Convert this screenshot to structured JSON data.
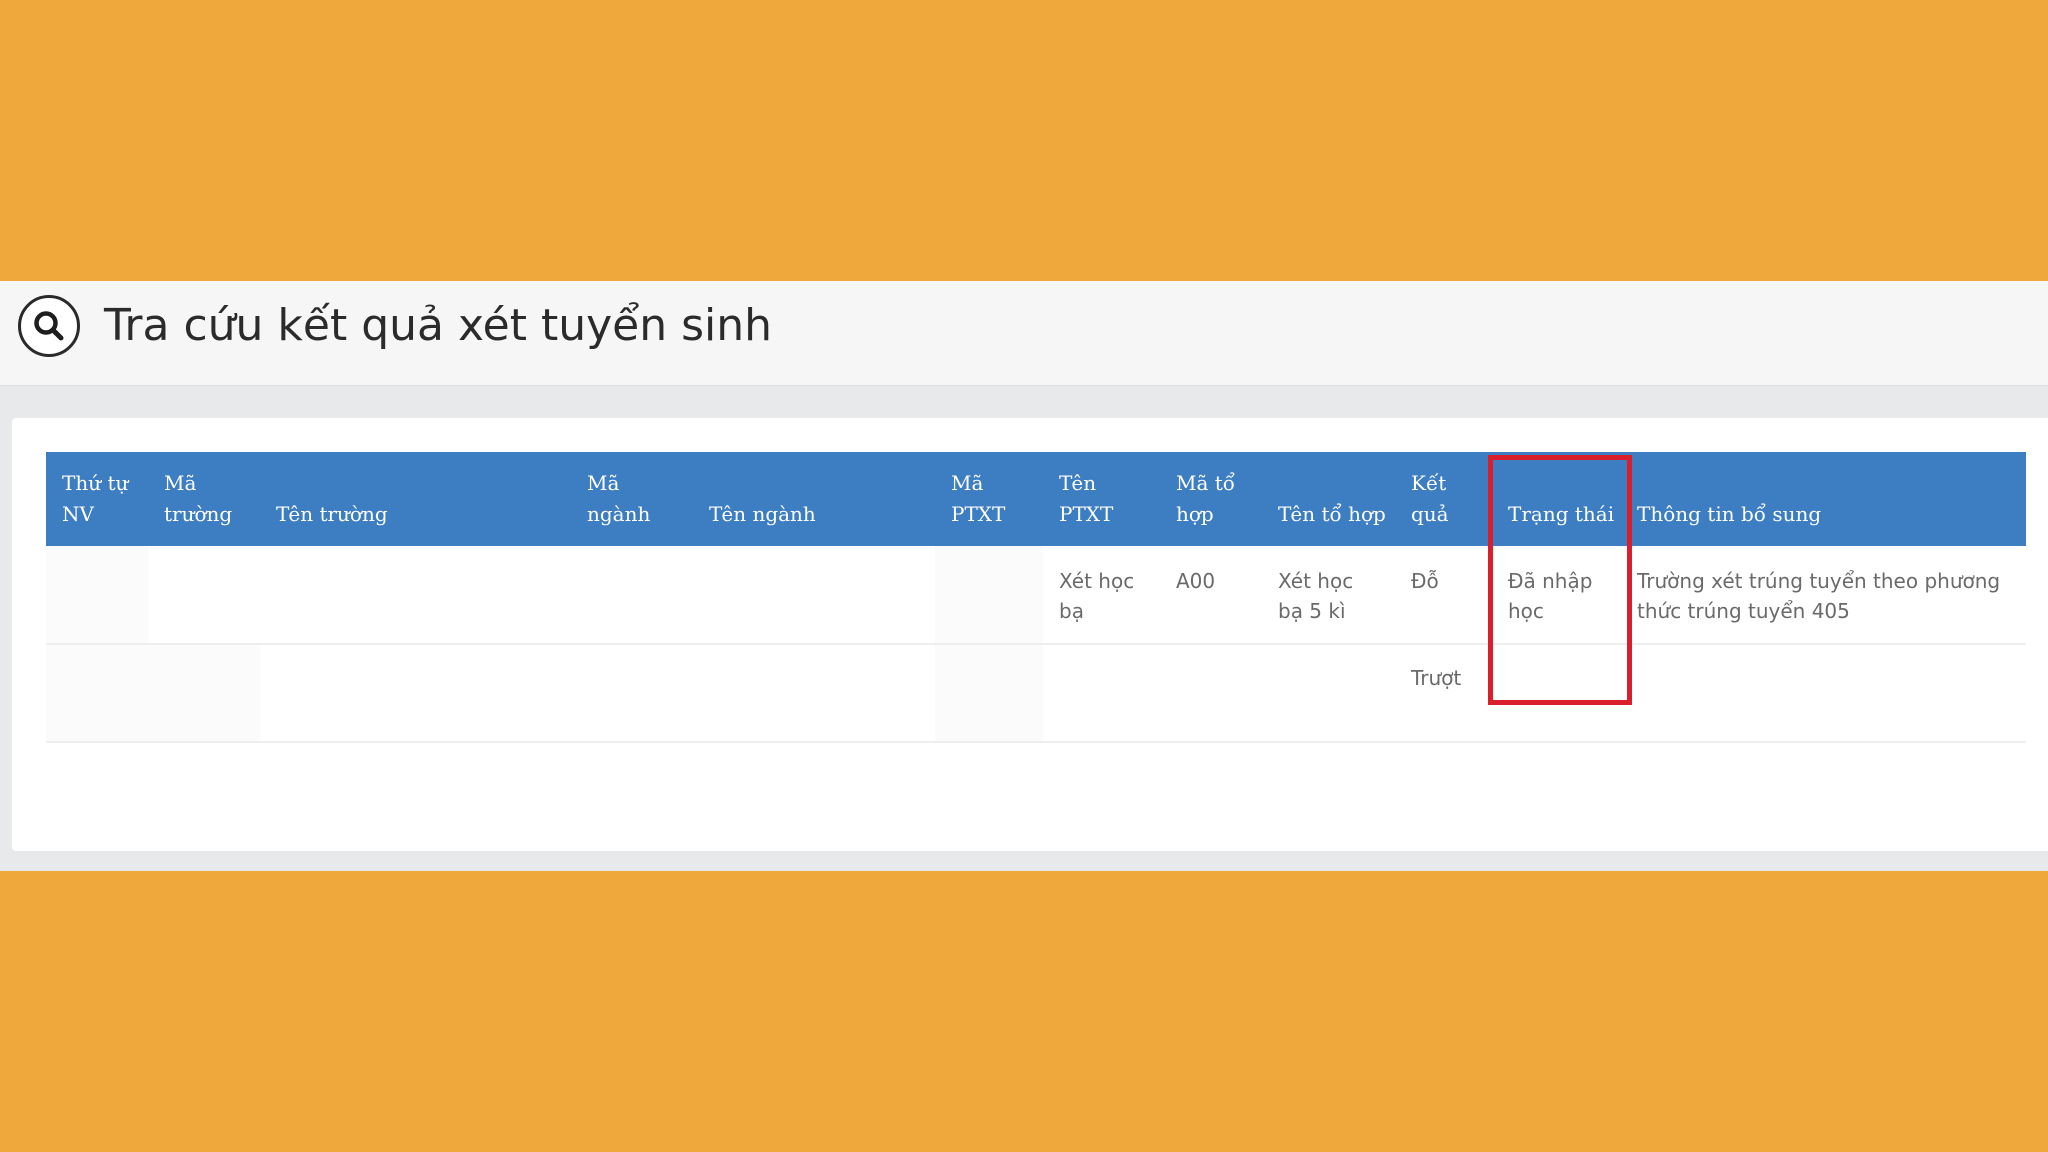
{
  "page": {
    "title": "Tra cứu kết quả xét tuyển sinh"
  },
  "icons": {
    "search": "search-icon"
  },
  "colors": {
    "background": "#EEA83C",
    "header_blue": "#3D7DC2",
    "highlight_red": "#D91F2B"
  },
  "table": {
    "headers": {
      "thu_tu_nv_1": "Thứ tự",
      "thu_tu_nv_2": "NV",
      "ma_truong_1": "Mã",
      "ma_truong_2": "trường",
      "ten_truong": "Tên trường",
      "ma_nganh_1": "Mã",
      "ma_nganh_2": "ngành",
      "ten_nganh": "Tên ngành",
      "ma_ptxt_1": "Mã",
      "ma_ptxt_2": "PTXT",
      "ten_ptxt_1": "Tên",
      "ten_ptxt_2": "PTXT",
      "ma_to_hop_1": "Mã tổ",
      "ma_to_hop_2": "hợp",
      "ten_to_hop": "Tên tổ hợp",
      "ket_qua_1": "Kết",
      "ket_qua_2": "quả",
      "trang_thai": "Trạng thái",
      "thong_tin_bo_sung": "Thông tin bổ sung"
    },
    "rows": [
      {
        "thu_tu_nv": "",
        "ma_truong": "",
        "ten_truong": "",
        "ma_nganh": "",
        "ten_nganh": "",
        "ma_ptxt": "",
        "ten_ptxt_1": "Xét học",
        "ten_ptxt_2": "bạ",
        "ma_to_hop": "A00",
        "ten_to_hop_1": "Xét học",
        "ten_to_hop_2": "bạ 5 kì",
        "ket_qua": "Đỗ",
        "trang_thai_1": "Đã nhập",
        "trang_thai_2": "học",
        "thong_tin_bo_sung_1": "Trường xét trúng tuyển theo phương",
        "thong_tin_bo_sung_2": "thức trúng tuyển 405"
      },
      {
        "thu_tu_nv": "",
        "ma_truong": "",
        "ten_truong": "",
        "ma_nganh": "",
        "ten_nganh": "",
        "ma_ptxt": "",
        "ten_ptxt": "",
        "ma_to_hop": "",
        "ten_to_hop": "",
        "ket_qua": "Trượt",
        "trang_thai": "",
        "thong_tin_bo_sung": ""
      }
    ]
  }
}
